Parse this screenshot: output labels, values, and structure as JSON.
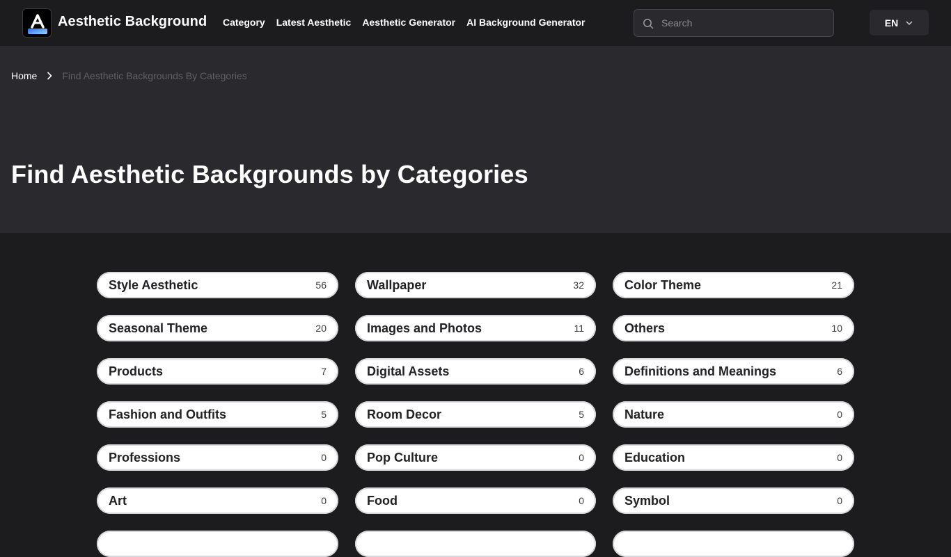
{
  "header": {
    "brand": "Aesthetic Background",
    "nav": [
      "Category",
      "Latest Aesthetic",
      "Aesthetic Generator",
      "AI Background Generator"
    ],
    "search_placeholder": "Search",
    "language": "EN"
  },
  "breadcrumb": {
    "home": "Home",
    "current": "Find Aesthetic Backgrounds By Categories"
  },
  "page_title": "Find Aesthetic Backgrounds by Categories",
  "categories": [
    {
      "name": "Style Aesthetic",
      "count": "56"
    },
    {
      "name": "Wallpaper",
      "count": "32"
    },
    {
      "name": "Color Theme",
      "count": "21"
    },
    {
      "name": "Seasonal Theme",
      "count": "20"
    },
    {
      "name": "Images and Photos",
      "count": "11"
    },
    {
      "name": "Others",
      "count": "10"
    },
    {
      "name": "Products",
      "count": "7"
    },
    {
      "name": "Digital Assets",
      "count": "6"
    },
    {
      "name": "Definitions and Meanings",
      "count": "6"
    },
    {
      "name": "Fashion and Outfits",
      "count": "5"
    },
    {
      "name": "Room Decor",
      "count": "5"
    },
    {
      "name": "Nature",
      "count": "0"
    },
    {
      "name": "Professions",
      "count": "0"
    },
    {
      "name": "Pop Culture",
      "count": "0"
    },
    {
      "name": "Education",
      "count": "0"
    },
    {
      "name": "Art",
      "count": "0"
    },
    {
      "name": "Food",
      "count": "0"
    },
    {
      "name": "Symbol",
      "count": "0"
    }
  ],
  "colors": {
    "header_bg": "#1c1c1f",
    "hero_bg": "#2a2a2e",
    "page_bg": "#1c1c1f",
    "pill_bg": "#ffffff",
    "text_primary": "#ffffff",
    "breadcrumb_muted": "#5f5f66"
  },
  "icons": {
    "logo": "brand-logo-icon",
    "search": "search-icon",
    "language_dropdown": "chevron-down-icon",
    "breadcrumb_separator": "chevron-right-icon"
  }
}
